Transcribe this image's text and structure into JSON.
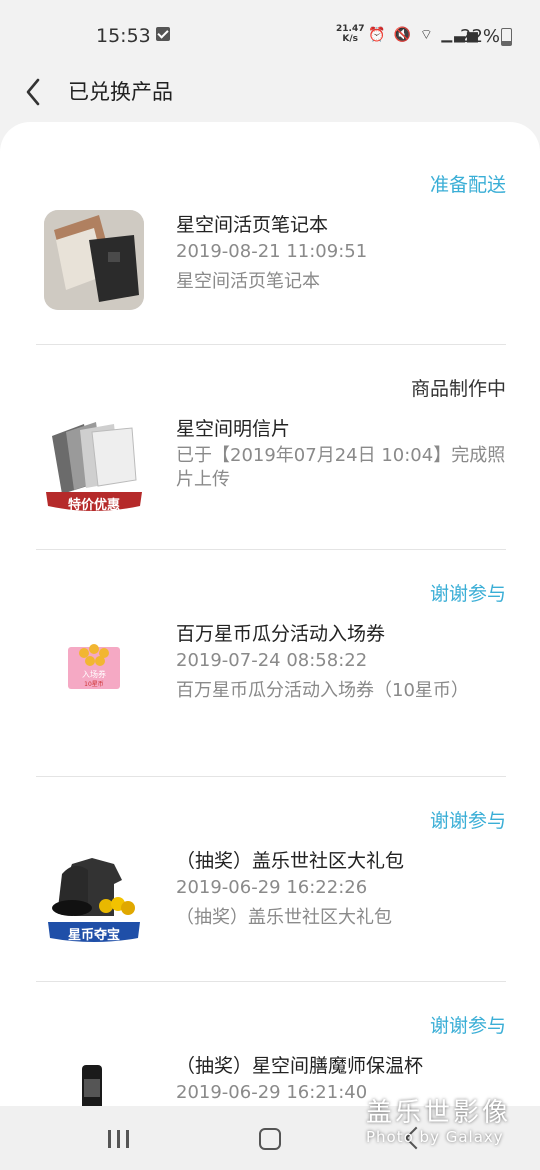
{
  "status_bar": {
    "time": "15:53",
    "net_speed_top": "21.47",
    "net_speed_bottom": "K/s",
    "icons": [
      "alarm-icon",
      "mute-icon",
      "wifi-icon",
      "4g-signal-icon"
    ],
    "battery": "22%"
  },
  "header": {
    "title": "已兑换产品"
  },
  "orders": [
    {
      "status": "准备配送",
      "name": "星空间活页笔记本",
      "line1": "2019-08-21 11:09:51",
      "line2": "星空间活页笔记本"
    },
    {
      "status": "商品制作中",
      "name": "星空间明信片",
      "line1": "已于【2019年07月24日 10:04】完成照片上传",
      "badge": "特价优惠"
    },
    {
      "status": "谢谢参与",
      "name": "百万星币瓜分活动入场券",
      "line1": "2019-07-24 08:58:22",
      "line2": "百万星币瓜分活动入场券（10星币）",
      "ticket_text": "入场券",
      "ticket_sub": "10星币"
    },
    {
      "status": "谢谢参与",
      "name": "（抽奖）盖乐世社区大礼包",
      "line1": "2019-06-29 16:22:26",
      "line2": "（抽奖）盖乐世社区大礼包",
      "badge": "星币夺宝"
    },
    {
      "status": "谢谢参与",
      "name": "（抽奖）星空间膳魔师保温杯",
      "line1": "2019-06-29 16:21:40"
    }
  ],
  "watermark": {
    "main": "盖乐世影像",
    "sub": "Photo by Galaxy"
  },
  "colors": {
    "accent_blue": "#3aaed6",
    "badge_red": "#b52a2a",
    "badge_blue": "#1f4fa8"
  }
}
